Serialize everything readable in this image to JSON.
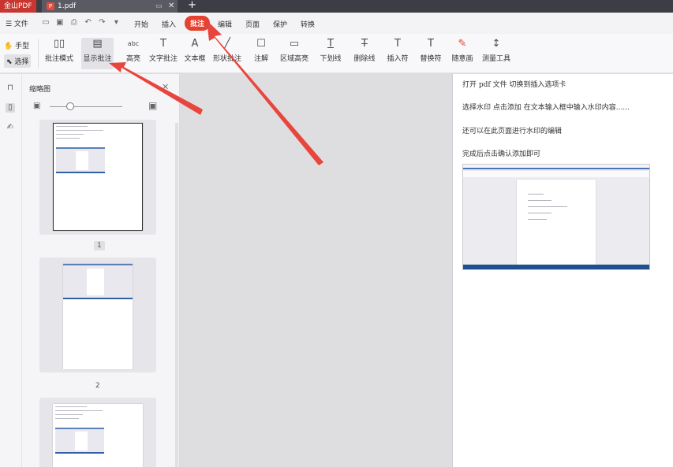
{
  "titlebar": {
    "app_name": "金山PDF",
    "doc_tab": "1.pdf",
    "new_tab": "+"
  },
  "menubar": {
    "file": "☰ 文件",
    "tabs": [
      "开始",
      "插入",
      "批注",
      "编辑",
      "页面",
      "保护",
      "转换"
    ],
    "active_tab": "批注"
  },
  "ribbon": {
    "hand": "手型",
    "select": "选择",
    "tools": [
      {
        "label": "批注模式",
        "icon": "annotation-mode-icon",
        "glyph": "▯▯"
      },
      {
        "label": "显示批注",
        "icon": "show-annotations-icon",
        "glyph": "▤"
      },
      {
        "label": "高亮",
        "icon": "highlight-icon",
        "glyph": "abc"
      },
      {
        "label": "文字批注",
        "icon": "text-annotation-icon",
        "glyph": "T"
      },
      {
        "label": "文本框",
        "icon": "textbox-icon",
        "glyph": "A"
      },
      {
        "label": "形状批注",
        "icon": "shape-annotation-icon",
        "glyph": "╱"
      },
      {
        "label": "注解",
        "icon": "note-icon",
        "glyph": "☐"
      },
      {
        "label": "区域高亮",
        "icon": "area-highlight-icon",
        "glyph": "▭"
      },
      {
        "label": "下划线",
        "icon": "underline-icon",
        "glyph": "T"
      },
      {
        "label": "删除线",
        "icon": "strikethrough-icon",
        "glyph": "T"
      },
      {
        "label": "插入符",
        "icon": "insert-caret-icon",
        "glyph": "T"
      },
      {
        "label": "替换符",
        "icon": "replace-icon",
        "glyph": "T"
      },
      {
        "label": "随意画",
        "icon": "freehand-icon",
        "glyph": "✎"
      },
      {
        "label": "测量工具",
        "icon": "measure-icon",
        "glyph": "↕"
      }
    ]
  },
  "thumbnail_panel": {
    "title": "缩略图",
    "pages": [
      "1",
      "2"
    ]
  },
  "document": {
    "lines": [
      "打开 pdf 文件    切换到插入选项卡",
      "选择水印      点击添加    在文本输入框中输入水印内容......",
      "还可以在此页面进行水印的编辑",
      "完成后点击确认添加即可"
    ]
  },
  "colors": {
    "accent": "#e5412f",
    "titlebar": "#3d3d46",
    "arrow": "#e8453c"
  }
}
